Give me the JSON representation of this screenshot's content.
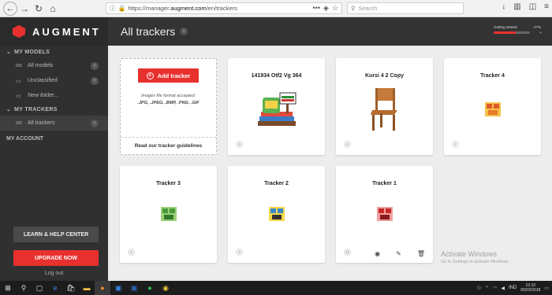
{
  "browser": {
    "url_prefix": "https://manager.",
    "url_domain": "augment.com",
    "url_path": "/en/trackers",
    "url_dots": "•••",
    "search_placeholder": "Search"
  },
  "sidebar": {
    "logo_text": "AUGMENT",
    "models_head": "MY MODELS",
    "models": [
      {
        "icon": "oo",
        "label": "All models",
        "count": "6"
      },
      {
        "icon": "▭",
        "label": "Unclassified",
        "count": "6"
      },
      {
        "icon": "▭",
        "label": "New folder...",
        "count": ""
      }
    ],
    "trackers_head": "MY TRACKERS",
    "trackers": [
      {
        "icon": "oo",
        "label": "All trackers",
        "count": "6"
      }
    ],
    "account": "MY ACCOUNT",
    "help_label": "LEARN & HELP CENTER",
    "upgrade_label": "UPGRADE NOW",
    "logout_label": "Log out"
  },
  "header": {
    "title": "All trackers",
    "title_count": "6",
    "getting_started": "Getting started",
    "getting_started_pct": "27%",
    "progress": 0.6
  },
  "upload": {
    "add_label": "Add tracker",
    "formats_line1": "Images file format accepted:",
    "formats_line2": ".JPG, .JPEG, .BMP, .PNG, .GIF",
    "guidelines": "Read our tracker guidelines"
  },
  "cards": [
    {
      "title": "141934 Otf2 Vg 364",
      "badge": "0"
    },
    {
      "title": "Kursi 4 2 Copy",
      "badge": "4"
    },
    {
      "title": "Tracker 4",
      "badge": "7"
    },
    {
      "title": "Tracker 3",
      "badge": "2"
    },
    {
      "title": "Tracker 2",
      "badge": "4"
    },
    {
      "title": "Tracker 1",
      "badge": "11"
    }
  ],
  "watermark": {
    "line1": "Activate Windows",
    "line2": "Go to Settings to activate Windows."
  },
  "taskbar": {
    "lang": "IND",
    "time": "13.10",
    "date": "05/03/2018"
  }
}
